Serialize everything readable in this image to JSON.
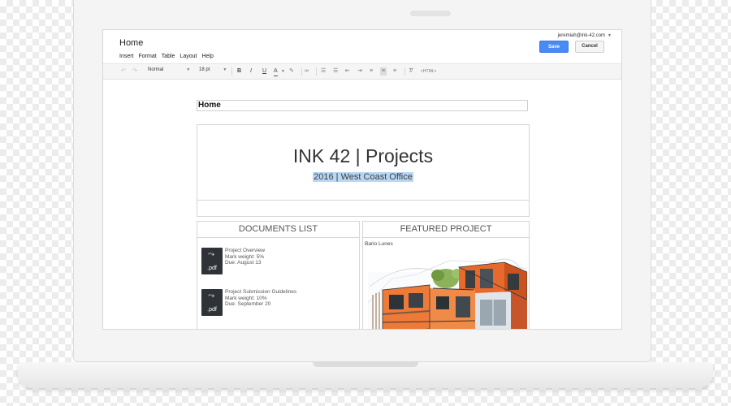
{
  "header": {
    "doc_title": "Home",
    "menu": [
      "Insert",
      "Format",
      "Table",
      "Layout",
      "Help"
    ],
    "user_email": "jeremiah@ink-42.com",
    "save_label": "Save",
    "cancel_label": "Cancel"
  },
  "toolbar": {
    "style_value": "Normal",
    "size_value": "18 pt",
    "bold": "B",
    "italic": "I",
    "underline": "U",
    "text_color": "A",
    "html_label": "<HTML>"
  },
  "document": {
    "section_field": "Home",
    "hero_title": "INK 42 | Projects",
    "hero_subtitle": "2016 | West Coast Office",
    "documents_panel": {
      "heading": "DOCUMENTS LIST",
      "items": [
        {
          "icon_label": ".pdf",
          "name": "Project Overview",
          "weight": "Mark weight: 5%",
          "due": "Due: August 13"
        },
        {
          "icon_label": ".pdf",
          "name": "Project Submission Guidelines",
          "weight": "Mark weight: 10%",
          "due": "Due: September 20"
        }
      ]
    },
    "featured_panel": {
      "heading": "FEATURED PROJECT",
      "caption": "Bario Lunes"
    }
  },
  "colors": {
    "accent": "#4a8af4",
    "highlight": "#b8d7f5",
    "building_orange": "#e8692c"
  }
}
